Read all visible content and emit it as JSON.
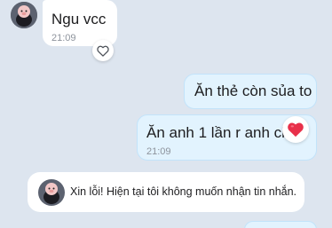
{
  "messages": [
    {
      "text": "Ngu vcc",
      "time": "21:09"
    },
    {
      "text": "Ăn thẻ còn sủa to"
    },
    {
      "text": "Ăn anh 1 lần r anh ch",
      "time": "21:09"
    }
  ],
  "notice": {
    "text": "Xin lỗi! Hiện tại tôi không muốn nhận tin nhắn."
  },
  "colors": {
    "background": "#dde5ef",
    "outgoing_bubble": "#e2f3fe",
    "heart": "#e8304a"
  },
  "icons": {
    "reaction_empty": "heart-outline-icon",
    "reaction_filled": "heart-icon"
  }
}
